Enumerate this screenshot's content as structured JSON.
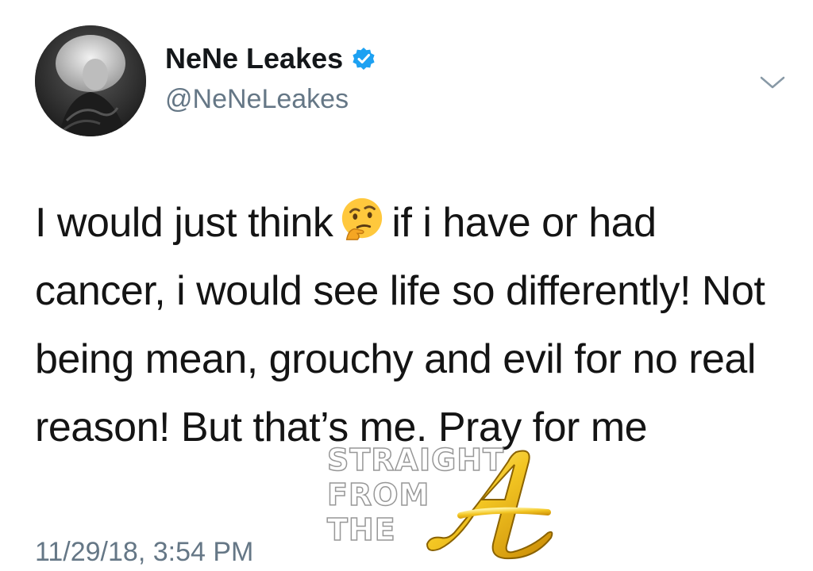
{
  "tweet": {
    "display_name": "NeNe Leakes",
    "handle": "@NeNeLeakes",
    "text_before_emoji": "I would just think",
    "text_after_emoji": "if i have or had cancer, i would see life so differently! Not being mean, grouchy and evil for no real reason! But that’s me. Pray for me",
    "timestamp": "11/29/18, 3:54 PM"
  },
  "icons": {
    "verified": "verified-badge-icon",
    "menu": "chevron-down-icon",
    "emoji": "thinking-face-emoji-icon"
  },
  "colors": {
    "verified_blue": "#1DA1F2",
    "secondary_text": "#657786",
    "primary_text": "#141414"
  },
  "watermark": {
    "line1": "STRAIGHT",
    "line2": "FROM",
    "line3": "THE"
  }
}
